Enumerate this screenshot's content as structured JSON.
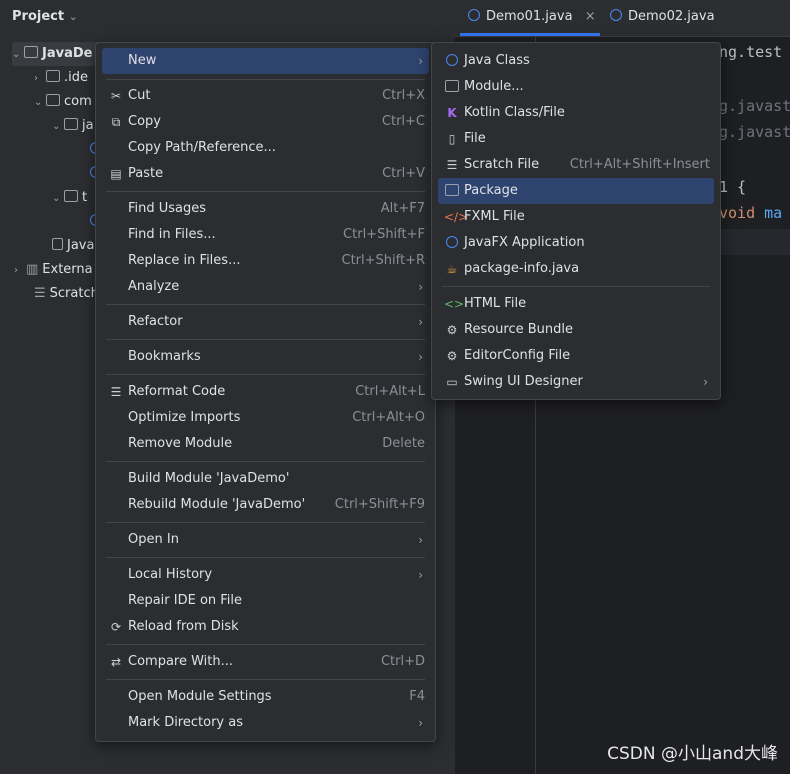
{
  "panel": {
    "title": "Project",
    "tree": [
      {
        "label": "JavaDe",
        "chev": "⌄"
      },
      {
        "label": ".ide",
        "chev": "›"
      },
      {
        "label": "com",
        "chev": "⌄"
      },
      {
        "label": "ja",
        "chev": "⌄"
      },
      {
        "label": "t",
        "chev": "⌄"
      },
      {
        "label": "Java",
        "chev": ""
      },
      {
        "label": "Externa",
        "chev": "›"
      },
      {
        "label": "Scratch",
        "chev": ""
      }
    ]
  },
  "tabs": [
    {
      "label": "Demo01.java",
      "close": "×"
    },
    {
      "label": "Demo02.java"
    }
  ],
  "code": {
    "line1": "ng.test",
    "line2": "g.javast",
    "line3": "g.javast",
    "line4": "1 {",
    "line5_kw": "void",
    "line5_name": "ma"
  },
  "context_menu": [
    {
      "label": "New",
      "icon": "",
      "shortcut": "",
      "submenu": true
    },
    {
      "label": "Cut",
      "icon": "✂",
      "shortcut": "Ctrl+X"
    },
    {
      "label": "Copy",
      "icon": "⧉",
      "shortcut": "Ctrl+C"
    },
    {
      "label": "Copy Path/Reference...",
      "icon": "",
      "shortcut": ""
    },
    {
      "label": "Paste",
      "icon": "📋",
      "shortcut": "Ctrl+V"
    },
    {
      "label": "Find Usages",
      "icon": "",
      "shortcut": "Alt+F7"
    },
    {
      "label": "Find in Files...",
      "icon": "",
      "shortcut": "Ctrl+Shift+F"
    },
    {
      "label": "Replace in Files...",
      "icon": "",
      "shortcut": "Ctrl+Shift+R"
    },
    {
      "label": "Analyze",
      "icon": "",
      "shortcut": "",
      "submenu": true
    },
    {
      "label": "Refactor",
      "icon": "",
      "shortcut": "",
      "submenu": true
    },
    {
      "label": "Bookmarks",
      "icon": "",
      "shortcut": "",
      "submenu": true
    },
    {
      "label": "Reformat Code",
      "icon": "☰",
      "shortcut": "Ctrl+Alt+L"
    },
    {
      "label": "Optimize Imports",
      "icon": "",
      "shortcut": "Ctrl+Alt+O"
    },
    {
      "label": "Remove Module",
      "icon": "",
      "shortcut": "Delete"
    },
    {
      "label": "Build Module 'JavaDemo'",
      "icon": "",
      "shortcut": ""
    },
    {
      "label": "Rebuild Module 'JavaDemo'",
      "icon": "",
      "shortcut": "Ctrl+Shift+F9"
    },
    {
      "label": "Open In",
      "icon": "",
      "shortcut": "",
      "submenu": true
    },
    {
      "label": "Local History",
      "icon": "",
      "shortcut": "",
      "submenu": true
    },
    {
      "label": "Repair IDE on File",
      "icon": "",
      "shortcut": ""
    },
    {
      "label": "Reload from Disk",
      "icon": "⟳",
      "shortcut": ""
    },
    {
      "label": "Compare With...",
      "icon": "⇄",
      "shortcut": "Ctrl+D"
    },
    {
      "label": "Open Module Settings",
      "icon": "",
      "shortcut": "F4"
    },
    {
      "label": "Mark Directory as",
      "icon": "",
      "shortcut": "",
      "submenu": true
    }
  ],
  "submenu": [
    {
      "label": "Java Class",
      "icon": "java-class-icon",
      "shortcut": ""
    },
    {
      "label": "Module...",
      "icon": "module-icon",
      "shortcut": ""
    },
    {
      "label": "Kotlin Class/File",
      "icon": "kotlin-icon",
      "shortcut": ""
    },
    {
      "label": "File",
      "icon": "file-icon",
      "shortcut": ""
    },
    {
      "label": "Scratch File",
      "icon": "scratch-icon",
      "shortcut": "Ctrl+Alt+Shift+Insert"
    },
    {
      "label": "Package",
      "icon": "package-icon",
      "shortcut": ""
    },
    {
      "label": "FXML File",
      "icon": "fxml-icon",
      "shortcut": ""
    },
    {
      "label": "JavaFX Application",
      "icon": "javafx-icon",
      "shortcut": ""
    },
    {
      "label": "package-info.java",
      "icon": "package-info-icon",
      "shortcut": ""
    },
    {
      "label": "HTML File",
      "icon": "html-icon",
      "shortcut": ""
    },
    {
      "label": "Resource Bundle",
      "icon": "resource-bundle-icon",
      "shortcut": ""
    },
    {
      "label": "EditorConfig File",
      "icon": "editorconfig-icon",
      "shortcut": ""
    },
    {
      "label": "Swing UI Designer",
      "icon": "swing-icon",
      "shortcut": "",
      "submenu": true
    }
  ],
  "colors": {
    "accent": "#3574f0",
    "selection": "#2e436e"
  },
  "watermark": "CSDN @小山and大峰"
}
